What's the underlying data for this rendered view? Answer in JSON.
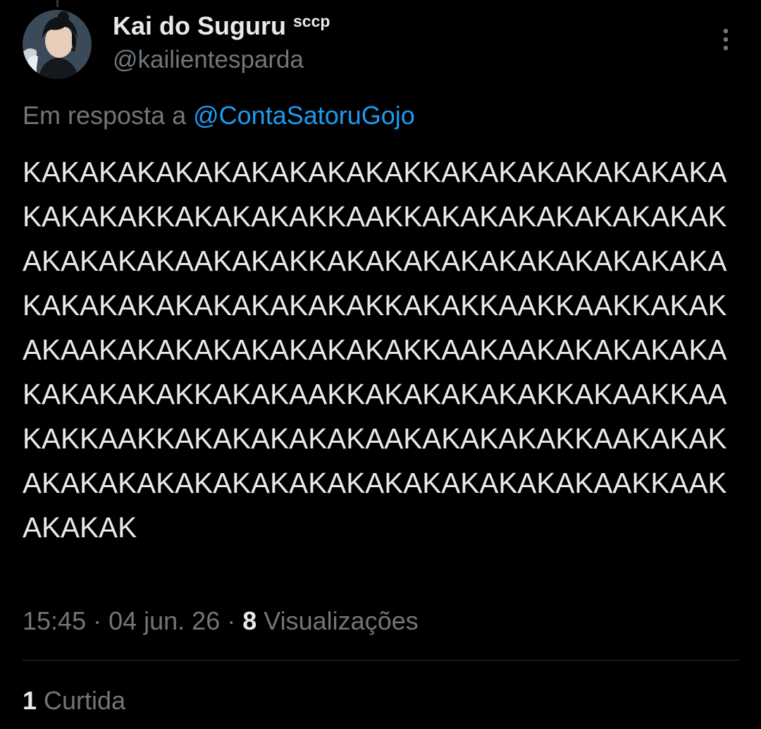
{
  "author": {
    "display_name": "Kai do Suguru",
    "name_tag": "sccp",
    "username": "@kailientesparda"
  },
  "reply_context": {
    "prefix": "Em resposta a ",
    "mention": "@ContaSatoruGojo"
  },
  "tweet": {
    "text": "KAKAKAKAKAKAKAKAKAKAKKAKAKAKAKAKAKAKAKAKAKAKKAKAKAKAKKAAKKAKAKAKAKAKAKAKAKAKAKAKAKAAKAKAKKAKAKAKAKAKAKAKAKAKAKAKAKAKAKAKAKAKAKAKAKKAKAKKAAKKAAKKAKAKAKAAKAKAKAKAKAKAKAKAKKAAKAAKAKAKAKAKAKAKAKAKAKKAKAKAAKKAKAKAKAKAKKAKAAKKAAKAKKAAKKAKAKAKAKAKAAKAKAKAKAKKAAKAKAKAKAKAKAKAKAKAKAKAKAKAKAKAKAKAKAAKKAAKAKAKAK"
  },
  "meta": {
    "time": "15:45",
    "separator": " · ",
    "date": "04 jun. 26",
    "views_count": "8",
    "views_label": " Visualizações"
  },
  "engagement": {
    "likes_count": "1",
    "likes_label": " Curtida"
  },
  "icons": {
    "more": "more-vertical-icon"
  },
  "colors": {
    "background": "#000000",
    "text_primary": "#e7e9ea",
    "text_secondary": "#71767b",
    "link": "#1d9bf0",
    "divider": "#2f3336"
  }
}
